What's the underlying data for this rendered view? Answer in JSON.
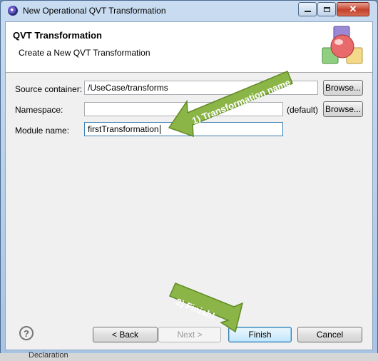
{
  "window": {
    "title": "New Operational QVT Transformation"
  },
  "banner": {
    "title": "QVT Transformation",
    "subtitle": "Create a New QVT Transformation"
  },
  "form": {
    "source_container_label": "Source container:",
    "source_container_value": "/UseCase/transforms",
    "namespace_label": "Namespace:",
    "namespace_value": "",
    "namespace_default": "(default)",
    "module_name_label": "Module name:",
    "module_name_value": "firstTransformation",
    "browse_label": "Browse..."
  },
  "buttons": {
    "back": "< Back",
    "next": "Next >",
    "finish": "Finish",
    "cancel": "Cancel"
  },
  "annotations": {
    "step1": "1) Transformation name",
    "step2": "2) Finish!"
  },
  "colors": {
    "arrow_green": "#8cb548",
    "arrow_border": "#5f8a24"
  },
  "taskbar": {
    "partial_text": "Declaration"
  }
}
